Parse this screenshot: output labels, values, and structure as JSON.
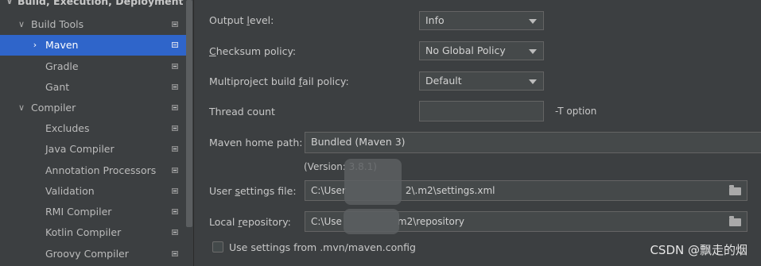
{
  "sidebar": {
    "section_header": "Build, Execution, Deployment",
    "items": [
      {
        "label": "Build Tools",
        "arrow": "∨"
      },
      {
        "label": "Maven",
        "arrow": "›"
      },
      {
        "label": "Gradle"
      },
      {
        "label": "Gant"
      },
      {
        "label": "Compiler",
        "arrow": "∨"
      },
      {
        "label": "Excludes"
      },
      {
        "label": "Java Compiler"
      },
      {
        "label": "Annotation Processors"
      },
      {
        "label": "Validation"
      },
      {
        "label": "RMI Compiler"
      },
      {
        "label": "Kotlin Compiler"
      },
      {
        "label": "Groovy Compiler"
      }
    ],
    "selected_item": "Maven"
  },
  "settings": {
    "output_level": {
      "label_pre": "Output ",
      "label_u": "l",
      "label_post": "evel:",
      "value": "Info"
    },
    "checksum_policy": {
      "label_pre": "",
      "label_u": "C",
      "label_post": "hecksum policy:",
      "value": "No Global Policy"
    },
    "multiproject_fail_policy": {
      "label_pre": "Multiproject build ",
      "label_u": "f",
      "label_post": "ail policy:",
      "value": "Default"
    },
    "thread_count": {
      "label": "Thread count",
      "value": "",
      "hint": "-T option"
    },
    "maven_home": {
      "label": "Maven home path:",
      "value": "Bundled (Maven 3)",
      "version": "(Version: 3.8.1)"
    },
    "user_settings": {
      "label_pre": "User ",
      "label_u": "s",
      "label_post": "ettings file:",
      "value_visible_start": "C:\\User",
      "value_visible_end": "2\\.m2\\settings.xml"
    },
    "local_repository": {
      "label_pre": "Local ",
      "label_u": "r",
      "label_post": "epository:",
      "value_visible_start": "C:\\Use",
      "value_visible_end": "m2\\repository"
    },
    "use_mvn_config": {
      "label": "Use settings from .mvn/maven.config",
      "checked": false
    }
  },
  "watermark": "CSDN @飘走的烟",
  "colors": {
    "background": "#3c3f41",
    "selection": "#2f65ca",
    "field_background": "#45494a",
    "text": "#bbbbbb"
  }
}
